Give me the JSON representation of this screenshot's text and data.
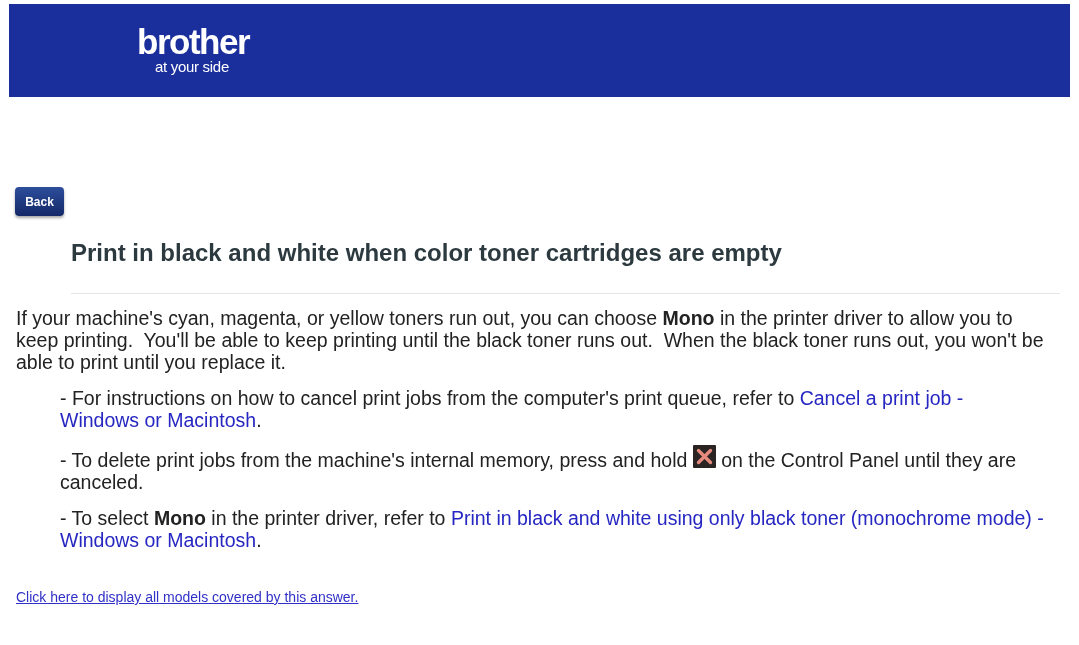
{
  "header": {
    "logo": {
      "wordmark": "brother",
      "tagline": "at your side"
    }
  },
  "back_button": {
    "label": "Back"
  },
  "title": "Print in black and white when color toner cartridges are empty",
  "intro": "If your machine's cyan, magenta, or yellow toners run out, you can choose **Mono** in the printer driver to allow you to keep printing.  You'll be able to keep printing until the black toner runs out.  When the black toner runs out, you won't be able to print until you replace it.",
  "notes": [
    {
      "segments": [
        {
          "kind": "text",
          "text": "- For instructions on how to cancel print jobs from the computer's print queue, refer to "
        },
        {
          "kind": "link",
          "lines": [
            "Cancel a print job -",
            "Windows or Macintosh"
          ]
        },
        {
          "kind": "text",
          "text": "."
        }
      ]
    },
    {
      "segments": [
        {
          "kind": "text",
          "text": "- To delete print jobs from the machine's internal memory, press and hold "
        },
        {
          "kind": "key_icon"
        },
        {
          "kind": "text",
          "text": " on the Control Panel until they are canceled."
        }
      ]
    },
    {
      "segments": [
        {
          "kind": "text",
          "text": "- To select **Mono** in the printer driver, refer to "
        },
        {
          "kind": "link",
          "lines": [
            "Print in black and white using only black toner (monochrome mode) -",
            "Windows or Macintosh"
          ]
        },
        {
          "kind": "text",
          "text": "."
        }
      ]
    }
  ],
  "footer_link": "Click here to display all models covered by this answer."
}
